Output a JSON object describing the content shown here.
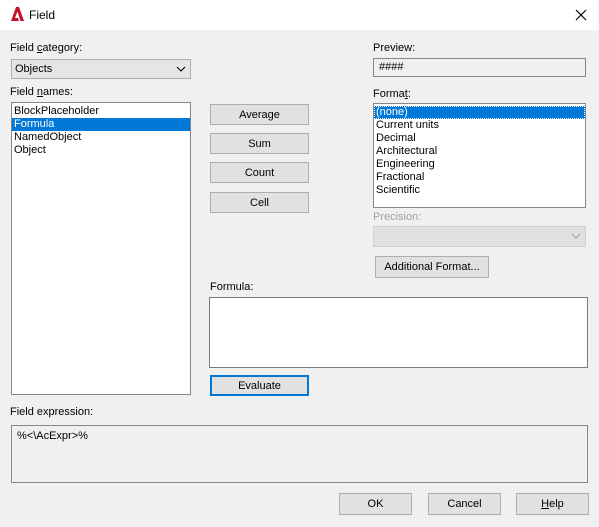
{
  "window": {
    "title": "Field"
  },
  "field_category": {
    "label_pre": "Field ",
    "label_u": "c",
    "label_post": "ategory:",
    "value": "Objects"
  },
  "field_names": {
    "label_pre": "Field ",
    "label_u": "n",
    "label_post": "ames:",
    "items": [
      "BlockPlaceholder",
      "Formula",
      "NamedObject",
      "Object"
    ]
  },
  "functions": {
    "average": "Average",
    "sum": "Sum",
    "count": "Count",
    "cell": "Cell"
  },
  "preview": {
    "label": "Preview:",
    "value": "####"
  },
  "format": {
    "label_pre": "Forma",
    "label_u": "t",
    "label_post": ":",
    "items": [
      "(none)",
      "Current units",
      "Decimal",
      "Architectural",
      "Engineering",
      "Fractional",
      "Scientific"
    ]
  },
  "precision": {
    "label": "Precision:",
    "value": ""
  },
  "additional_format": {
    "label": "Additional Format..."
  },
  "formula": {
    "label": "Formula:",
    "value": ""
  },
  "evaluate": {
    "label": "Evaluate"
  },
  "field_expression": {
    "label": "Field expression:",
    "value": "%<\\AcExpr>%"
  },
  "footer": {
    "ok": "OK",
    "cancel": "Cancel",
    "help_u": "H",
    "help_rest": "elp"
  },
  "colors": {
    "selection": "#0078d7",
    "app_icon": "#c8102e"
  }
}
